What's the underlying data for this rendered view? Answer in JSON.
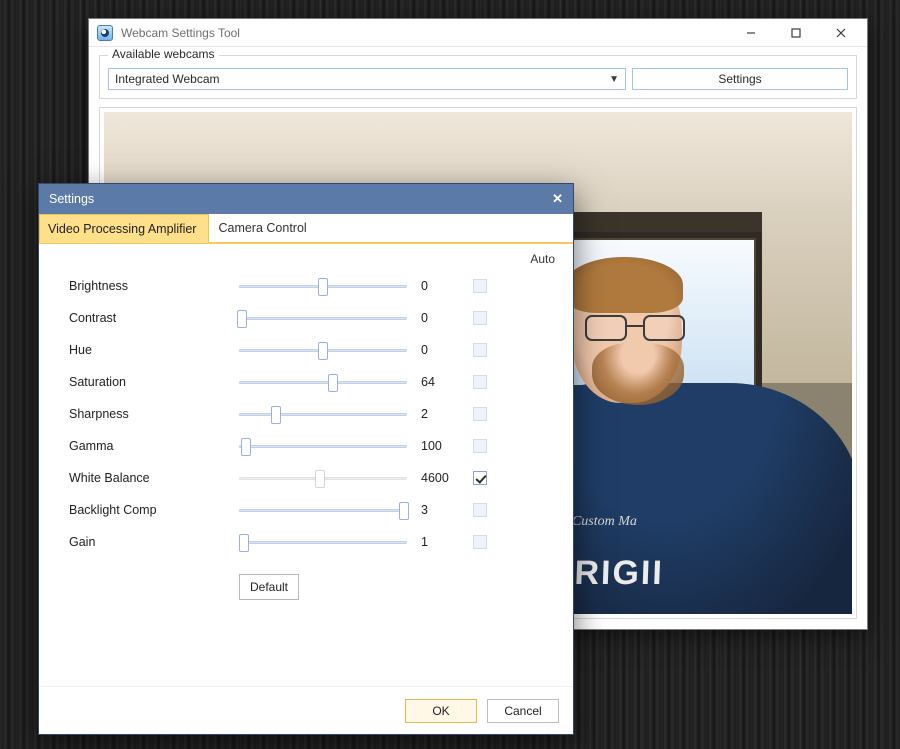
{
  "main": {
    "title": "Webcam Settings Tool",
    "group_label": "Available webcams",
    "selected_webcam": "Integrated Webcam",
    "settings_btn": "Settings",
    "shirt_text": "ORIGII",
    "shirt_script": "Custom Ma"
  },
  "dialog": {
    "title": "Settings",
    "tabs": {
      "active": "Video Processing Amplifier",
      "inactive": "Camera Control"
    },
    "auto_header": "Auto",
    "default_btn": "Default",
    "ok": "OK",
    "cancel": "Cancel",
    "sliders": [
      {
        "label": "Brightness",
        "value": "0",
        "pos": 0.5,
        "auto": false,
        "disabled": false
      },
      {
        "label": "Contrast",
        "value": "0",
        "pos": 0.02,
        "auto": false,
        "disabled": false
      },
      {
        "label": "Hue",
        "value": "0",
        "pos": 0.5,
        "auto": false,
        "disabled": false
      },
      {
        "label": "Saturation",
        "value": "64",
        "pos": 0.56,
        "auto": false,
        "disabled": false
      },
      {
        "label": "Sharpness",
        "value": "2",
        "pos": 0.22,
        "auto": false,
        "disabled": false
      },
      {
        "label": "Gamma",
        "value": "100",
        "pos": 0.04,
        "auto": false,
        "disabled": false
      },
      {
        "label": "White Balance",
        "value": "4600",
        "pos": 0.48,
        "auto": true,
        "disabled": true
      },
      {
        "label": "Backlight Comp",
        "value": "3",
        "pos": 0.98,
        "auto": false,
        "disabled": false
      },
      {
        "label": "Gain",
        "value": "1",
        "pos": 0.03,
        "auto": false,
        "disabled": false
      }
    ]
  }
}
